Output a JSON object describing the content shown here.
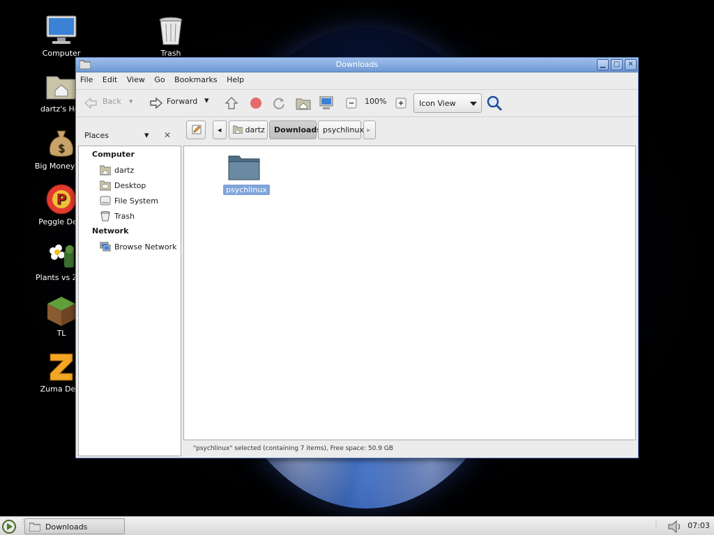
{
  "desktop": {
    "icons": [
      {
        "label": "Computer"
      },
      {
        "label": "Trash"
      },
      {
        "label": "dartz's Hor"
      },
      {
        "label": "Big Money De"
      },
      {
        "label": "Peggle Delu"
      },
      {
        "label": "Plants vs Zon"
      },
      {
        "label": "TL"
      },
      {
        "label": "Zuma Delu"
      }
    ]
  },
  "window": {
    "title": "Downloads",
    "menu": [
      "File",
      "Edit",
      "View",
      "Go",
      "Bookmarks",
      "Help"
    ],
    "toolbar": {
      "back_label": "Back",
      "forward_label": "Forward",
      "zoom_level": "100%",
      "view_mode": "Icon View"
    },
    "location": {
      "crumbs": [
        "dartz",
        "Downloads",
        "psychlinux"
      ]
    },
    "sidebar": {
      "header": "Places",
      "sections": [
        {
          "title": "Computer",
          "items": [
            "dartz",
            "Desktop",
            "File System",
            "Trash"
          ]
        },
        {
          "title": "Network",
          "items": [
            "Browse Network"
          ]
        }
      ]
    },
    "files": [
      {
        "name": "psychlinux",
        "type": "folder",
        "selected": true
      }
    ],
    "status": "\"psychlinux\" selected (containing 7 items), Free space: 50.9 GB"
  },
  "taskbar": {
    "task_label": "Downloads",
    "clock": "07:03"
  },
  "colors": {
    "titlebar": "#7aa2d8",
    "selection": "#7fa4da",
    "folder": "#5f7d94"
  }
}
